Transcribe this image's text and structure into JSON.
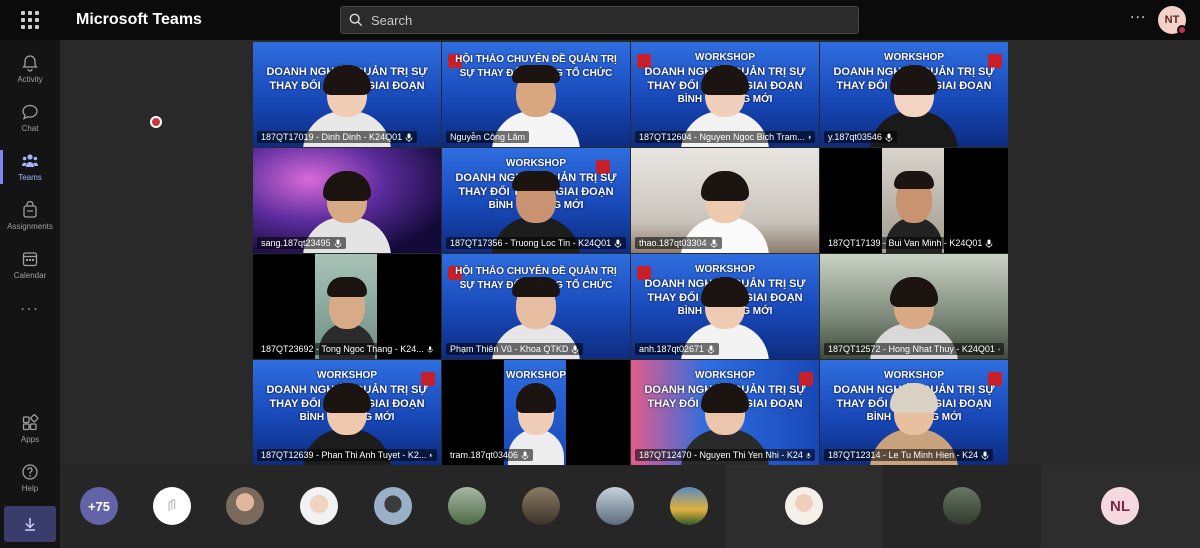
{
  "app": {
    "title": "Microsoft Teams"
  },
  "search": {
    "placeholder": "Search"
  },
  "header": {
    "more_label": "···",
    "user_initials": "NT"
  },
  "rail": {
    "items": [
      {
        "label": "Activity",
        "icon": "bell-icon"
      },
      {
        "label": "Chat",
        "icon": "chat-icon"
      },
      {
        "label": "Teams",
        "icon": "teams-icon"
      },
      {
        "label": "Assignments",
        "icon": "assignments-icon"
      },
      {
        "label": "Calendar",
        "icon": "calendar-icon"
      },
      {
        "label": "Apps",
        "icon": "apps-icon"
      },
      {
        "label": "Help",
        "icon": "help-icon"
      }
    ],
    "more_label": "···"
  },
  "banner_texts": {
    "workshop": "WORKSHOP",
    "line_a": "DOANH NGHIỆP QUẢN TRỊ SỰ",
    "line_b": "THAY ĐỔI TRONG GIAI ĐOẠN",
    "line_c": "BÌNH THƯỜNG MỚI",
    "hoi_thao_1": "HỘI THẢO CHUYÊN ĐỀ QUẢN TRỊ",
    "hoi_thao_2": "SỰ THAY ĐỔI TRONG TỔ CHỨC"
  },
  "participants": [
    {
      "name": "187QT17019 - Dinh Dinh - K24Q01"
    },
    {
      "name": "Nguyễn Công Lâm"
    },
    {
      "name": "187QT12604 - Nguyen Ngoc Bich Tram..."
    },
    {
      "name": "y.187qt03546"
    },
    {
      "name": "sang.187qt23495"
    },
    {
      "name": "187QT17356 - Truong Loc Tin - K24Q01"
    },
    {
      "name": "thao.187qt03304"
    },
    {
      "name": "187QT17139 - Bui Van Minh - K24Q01"
    },
    {
      "name": "187QT23692 - Tong Ngoc Thang - K24..."
    },
    {
      "name": "Phạm Thiên Vũ - Khoa QTKD"
    },
    {
      "name": "anh.187qt02671"
    },
    {
      "name": "187QT12572 - Hong Nhat Thuy - K24Q01"
    },
    {
      "name": "187QT12639 - Phan Thi Anh Tuyet - K2..."
    },
    {
      "name": "tram.187qt03406"
    },
    {
      "name": "187QT12470 - Nguyen Thi Yen Nhi - K24"
    },
    {
      "name": "187QT12314 - Le Tu Minh Hien - K24"
    }
  ],
  "strip": {
    "overflow_count": "+75",
    "last_initials": "NL"
  },
  "colors": {
    "accent": "#6264a7",
    "record": "#d13438",
    "badge_red": "#c4314b"
  }
}
